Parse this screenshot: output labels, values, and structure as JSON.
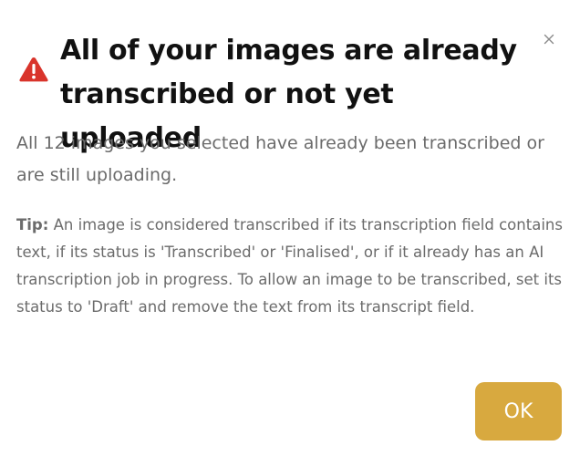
{
  "dialog": {
    "icon": "warning-triangle-icon",
    "title": "All of your images are already transcribed or not yet uploaded",
    "close_icon": "close-icon",
    "message": "All 12 images you selected have already been transcribed or are still uploading.",
    "tip_label": "Tip:",
    "tip_text": " An image is considered transcribed if its transcription field contains text, if its status is 'Transcribed' or 'Finalised', or if it already has an AI transcription job in progress. To allow an image to be transcribed, set its status to 'Draft' and remove the text from its transcript field.",
    "ok_label": "OK"
  },
  "colors": {
    "warning_red": "#d9342b",
    "accent_gold": "#d8a93f",
    "title_text": "#111111",
    "body_text": "#6b6b6b"
  }
}
